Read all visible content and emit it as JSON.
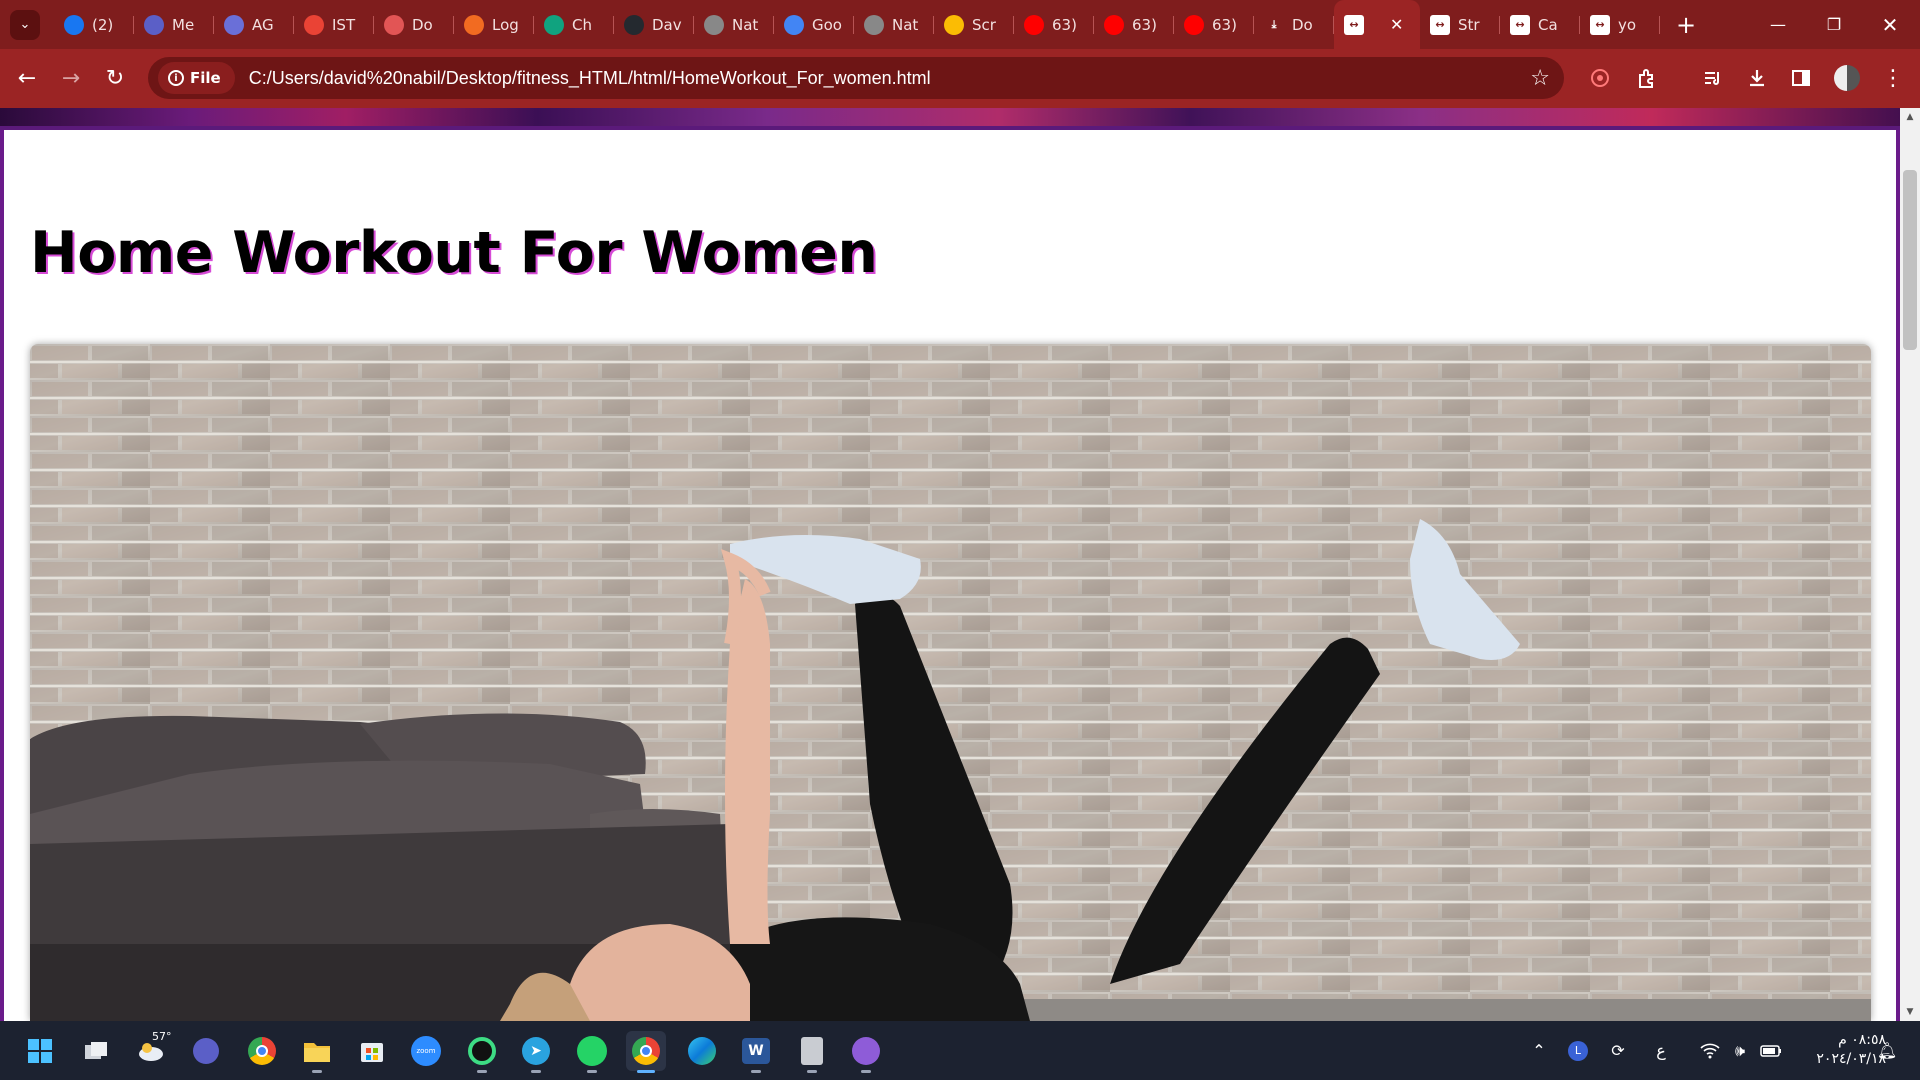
{
  "browser": {
    "tabs": [
      {
        "label": "(2)",
        "icon": "facebook-icon",
        "color": "#1877f2"
      },
      {
        "label": "Me",
        "icon": "teams-icon",
        "color": "#5b5fc7"
      },
      {
        "label": "AG",
        "icon": "site-icon",
        "color": "#6a6fd8"
      },
      {
        "label": "IST",
        "icon": "gmail-icon",
        "color": "#ea4335"
      },
      {
        "label": "Do",
        "icon": "site-icon",
        "color": "#e25555"
      },
      {
        "label": "Log",
        "icon": "site-icon",
        "color": "#f26b21"
      },
      {
        "label": "Ch",
        "icon": "chatgpt-icon",
        "color": "#10a37f"
      },
      {
        "label": "Dav",
        "icon": "github-icon",
        "color": "#24292f"
      },
      {
        "label": "Nat",
        "icon": "globe-icon",
        "color": "#888888"
      },
      {
        "label": "Goo",
        "icon": "google-translate-icon",
        "color": "#4285f4"
      },
      {
        "label": "Nat",
        "icon": "globe-icon",
        "color": "#888888"
      },
      {
        "label": "Scr",
        "icon": "google-drive-icon",
        "color": "#fbbc04"
      },
      {
        "label": "63)",
        "icon": "youtube-icon",
        "color": "#ff0000"
      },
      {
        "label": "63)",
        "icon": "youtube-icon",
        "color": "#ff0000"
      },
      {
        "label": "63)",
        "icon": "youtube-icon",
        "color": "#ff0000"
      },
      {
        "label": "Do",
        "icon": "download-icon",
        "color": "#ffffff"
      },
      {
        "label": "",
        "icon": "resize-icon",
        "color": "#ffffff",
        "active": true
      },
      {
        "label": "Str",
        "icon": "resize-icon",
        "color": "#ffffff"
      },
      {
        "label": "Ca",
        "icon": "resize-icon",
        "color": "#ffffff"
      },
      {
        "label": "yo",
        "icon": "resize-icon",
        "color": "#ffffff"
      }
    ],
    "chip_label": "File",
    "url": "C:/Users/david%20nabil/Desktop/fitness_HTML/html/HomeWorkout_For_women.html"
  },
  "page": {
    "title": "Home Workout For Women"
  },
  "taskbar": {
    "weather": "57°",
    "time": "٠٨:٥٨ م",
    "date": "٢٠٢٤/٠٣/١٨",
    "lang": "ع"
  },
  "colors": {
    "chrome_dark": "#7f1d1d",
    "chrome_toolbar": "#9b2424",
    "title_shadow": "#d64bd6",
    "frame": "#6a1b8a"
  }
}
